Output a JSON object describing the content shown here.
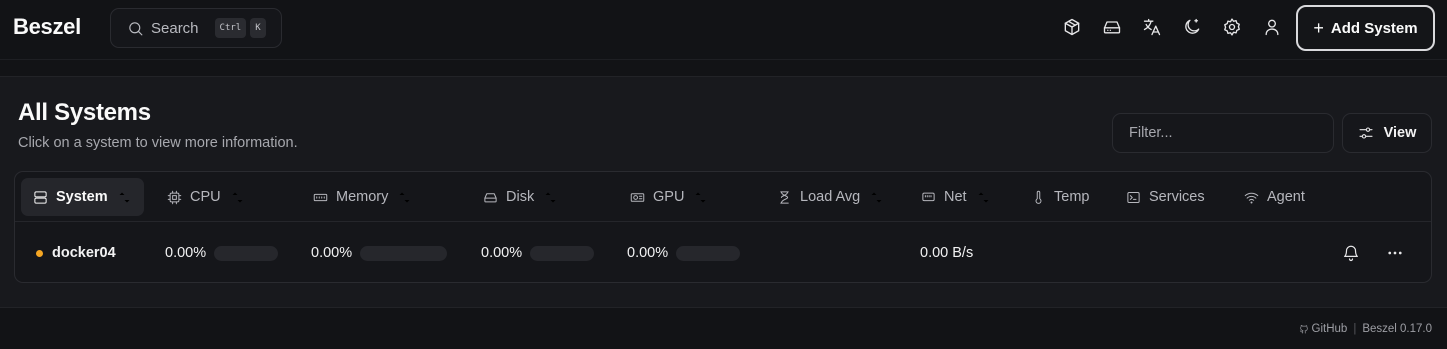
{
  "header": {
    "logo": "Beszel",
    "search": {
      "label": "Search",
      "shortcut": [
        "Ctrl",
        "K"
      ]
    },
    "icons": [
      "containers-icon",
      "disk-icon",
      "language-icon",
      "theme-icon",
      "settings-icon",
      "user-icon"
    ],
    "add_system": "Add System"
  },
  "main": {
    "title": "All Systems",
    "subtitle": "Click on a system to view more information.",
    "filter_placeholder": "Filter...",
    "view_label": "View"
  },
  "table": {
    "columns": [
      {
        "label": "System",
        "icon": "server-icon",
        "sortable": true
      },
      {
        "label": "CPU",
        "icon": "cpu-icon",
        "sortable": true
      },
      {
        "label": "Memory",
        "icon": "memory-icon",
        "sortable": true
      },
      {
        "label": "Disk",
        "icon": "disk-icon",
        "sortable": true
      },
      {
        "label": "GPU",
        "icon": "gpu-icon",
        "sortable": true
      },
      {
        "label": "Load Avg",
        "icon": "hourglass-icon",
        "sortable": true
      },
      {
        "label": "Net",
        "icon": "network-icon",
        "sortable": true
      },
      {
        "label": "Temp",
        "icon": "thermometer-icon",
        "sortable": false
      },
      {
        "label": "Services",
        "icon": "terminal-icon",
        "sortable": false
      },
      {
        "label": "Agent",
        "icon": "wifi-icon",
        "sortable": false
      }
    ],
    "rows": [
      {
        "name": "docker04",
        "status_color": "#f5a623",
        "cpu": "0.00%",
        "cpu_fraction": 0,
        "memory": "0.00%",
        "memory_fraction": 0,
        "disk": "0.00%",
        "disk_fraction": 0,
        "gpu": "0.00%",
        "gpu_fraction": 0,
        "load_avg": "",
        "net": "0.00 B/s",
        "temp": "",
        "services": "",
        "agent": ""
      }
    ]
  },
  "footer": {
    "github": "GitHub",
    "version": "Beszel 0.17.0"
  }
}
